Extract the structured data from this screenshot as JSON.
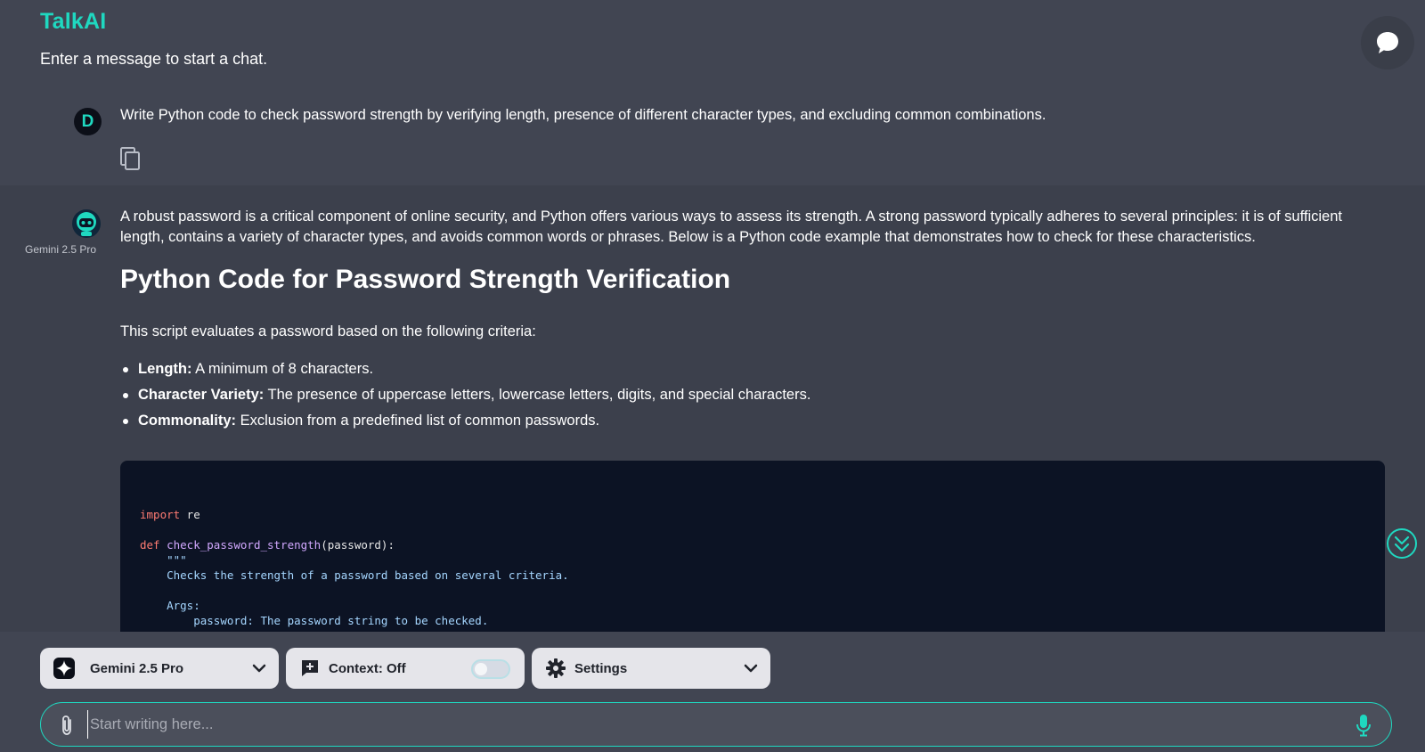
{
  "header": {
    "brand": "TalkAI",
    "subtitle": "Enter a message to start a chat."
  },
  "user_message": {
    "avatar_initial": "D",
    "text": "Write Python code to check password strength by verifying length, presence of different character types, and excluding common combinations."
  },
  "assistant_message": {
    "model_name": "Gemini 2.5 Pro",
    "intro": "A robust password is a critical component of online security, and Python offers various ways to assess its strength. A strong password typically adheres to several principles: it is of sufficient length, contains a variety of character types, and avoids common words or phrases. Below is a Python code example that demonstrates how to check for these characteristics.",
    "heading": "Python Code for Password Strength Verification",
    "criteria_intro": "This script evaluates a password based on the following criteria:",
    "criteria": [
      {
        "term": "Length:",
        "desc": " A minimum of 8 characters."
      },
      {
        "term": "Character Variety:",
        "desc": " The presence of uppercase letters, lowercase letters, digits, and special characters."
      },
      {
        "term": "Commonality:",
        "desc": " Exclusion from a predefined list of common passwords."
      }
    ],
    "code": {
      "line1_kw": "import",
      "line1_rest": " re",
      "line2_kw": "def",
      "line2_fn": "check_password_strength",
      "line2_rest": "(password):",
      "doc_open": "\"\"\"",
      "doc_line1": "Checks the strength of a password based on several criteria.",
      "doc_args": "Args:",
      "doc_arg1": "password: The password string to be checked."
    }
  },
  "toolbar": {
    "model_label": "Gemini 2.5 Pro",
    "context_label": "Context: Off",
    "context_enabled": false,
    "settings_label": "Settings"
  },
  "composer": {
    "placeholder": "Start writing here..."
  },
  "colors": {
    "accent": "#1fd8c0",
    "background": "#414552",
    "assistant_background": "#3c404c",
    "code_background": "#0c1324"
  },
  "icons": {
    "chat_fab": "speech-bubble-icon",
    "copy": "copy-icon",
    "scroll_down": "double-chevron-down-icon",
    "model": "gemini-sparkle-icon",
    "context": "add-context-icon",
    "settings": "gear-icon",
    "attach": "paperclip-icon",
    "mic": "microphone-icon"
  }
}
